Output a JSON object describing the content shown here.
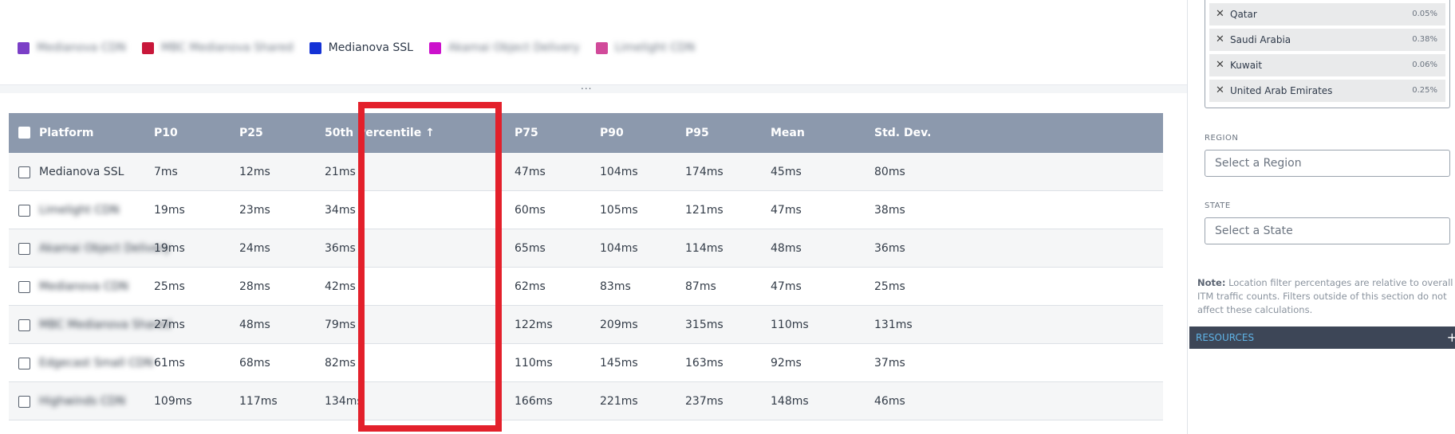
{
  "legend": [
    {
      "label": "Medianova CDN",
      "color": "#7b3fc7",
      "blurred": true
    },
    {
      "label": "MBC Medianova Shared",
      "color": "#c8173a",
      "blurred": true
    },
    {
      "label": "Medianova SSL",
      "color": "#1432d6",
      "blurred": false
    },
    {
      "label": "Akamai Object Delivery",
      "color": "#cc11cc",
      "blurred": true
    },
    {
      "label": "Limelight CDN",
      "color": "#d14a9a",
      "blurred": true
    }
  ],
  "divider": {
    "dots": "..."
  },
  "table": {
    "headers": {
      "platform": "Platform",
      "p10": "P10",
      "p25": "P25",
      "p50": "50th Percentile ↑",
      "p75": "P75",
      "p90": "P90",
      "p95": "P95",
      "mean": "Mean",
      "std": "Std. Dev."
    },
    "rows": [
      {
        "platform": "Medianova SSL",
        "blurred": false,
        "p10": "7ms",
        "p25": "12ms",
        "p50": "21ms",
        "p75": "47ms",
        "p90": "104ms",
        "p95": "174ms",
        "mean": "45ms",
        "std": "80ms"
      },
      {
        "platform": "Limelight CDN",
        "blurred": true,
        "p10": "19ms",
        "p25": "23ms",
        "p50": "34ms",
        "p75": "60ms",
        "p90": "105ms",
        "p95": "121ms",
        "mean": "47ms",
        "std": "38ms"
      },
      {
        "platform": "Akamai Object Delivery",
        "blurred": true,
        "p10": "19ms",
        "p25": "24ms",
        "p50": "36ms",
        "p75": "65ms",
        "p90": "104ms",
        "p95": "114ms",
        "mean": "48ms",
        "std": "36ms"
      },
      {
        "platform": "Medianova CDN",
        "blurred": true,
        "p10": "25ms",
        "p25": "28ms",
        "p50": "42ms",
        "p75": "62ms",
        "p90": "83ms",
        "p95": "87ms",
        "mean": "47ms",
        "std": "25ms"
      },
      {
        "platform": "MBC Medianova Shared",
        "blurred": true,
        "p10": "27ms",
        "p25": "48ms",
        "p50": "79ms",
        "p75": "122ms",
        "p90": "209ms",
        "p95": "315ms",
        "mean": "110ms",
        "std": "131ms"
      },
      {
        "platform": "Edgecast Small CDN",
        "blurred": true,
        "p10": "61ms",
        "p25": "68ms",
        "p50": "82ms",
        "p75": "110ms",
        "p90": "145ms",
        "p95": "163ms",
        "mean": "92ms",
        "std": "37ms"
      },
      {
        "platform": "Highwinds CDN",
        "blurred": true,
        "p10": "109ms",
        "p25": "117ms",
        "p50": "134ms",
        "p75": "166ms",
        "p90": "221ms",
        "p95": "237ms",
        "mean": "148ms",
        "std": "46ms"
      }
    ]
  },
  "sidebar": {
    "countries": [
      {
        "name": "Qatar",
        "pct": "0.05%"
      },
      {
        "name": "Saudi Arabia",
        "pct": "0.38%"
      },
      {
        "name": "Kuwait",
        "pct": "0.06%"
      },
      {
        "name": "United Arab Emirates",
        "pct": "0.25%"
      }
    ],
    "region_label": "REGION",
    "region_placeholder": "Select a Region",
    "state_label": "STATE",
    "state_placeholder": "Select a State",
    "note_label": "Note:",
    "note_text": " Location filter percentages are relative to overall ITM traffic counts. Filters outside of this section do not affect these calculations.",
    "resources_label": "RESOURCES",
    "resources_toggle": "+"
  },
  "colors": {
    "header": "#8c99ad",
    "highlight": "#e3202b",
    "resources_bg": "#3d4657"
  }
}
